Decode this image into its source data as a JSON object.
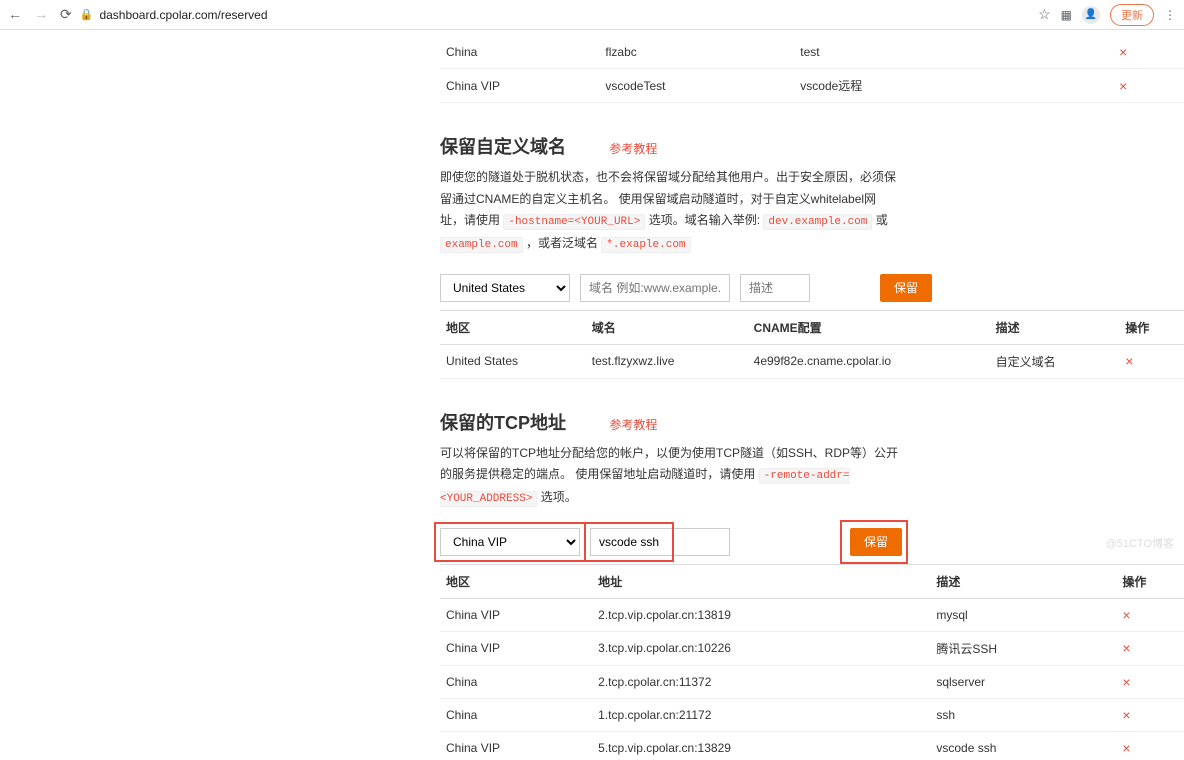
{
  "browser": {
    "url": "dashboard.cpolar.com/reserved",
    "update": "更新",
    "menu": "⋮"
  },
  "top_rows": [
    {
      "region": "China",
      "name": "flzabc",
      "desc": "test"
    },
    {
      "region": "China VIP",
      "name": "vscodeTest",
      "desc": "vscode远程"
    }
  ],
  "custom_domain": {
    "title": "保留自定义域名",
    "ref": "参考教程",
    "desc_parts": {
      "p1": "即使您的隧道处于脱机状态，也不会将保留域分配给其他用户。出于安全原因，必须保留通过CNAME的自定义主机名。 使用保留域启动隧道时，对于自定义whitelabel网址，请使用 ",
      "code1": "-hostname=<YOUR_URL>",
      "p2": " 选项。域名输入举例: ",
      "code2": "dev.example.com",
      "p3": " 或 ",
      "code3": "example.com",
      "p4": " ，或者泛域名 ",
      "code4": "*.exaple.com"
    },
    "form": {
      "region": "United States",
      "domain_ph": "域名 例如:www.example.com",
      "desc_ph": "描述",
      "btn": "保留"
    },
    "headers": {
      "region": "地区",
      "domain": "域名",
      "cname": "CNAME配置",
      "desc": "描述",
      "op": "操作"
    },
    "rows": [
      {
        "region": "United States",
        "domain": "test.flzyxwz.live",
        "cname": "4e99f82e.cname.cpolar.io",
        "desc": "自定义域名"
      }
    ]
  },
  "tcp": {
    "title": "保留的TCP地址",
    "ref": "参考教程",
    "desc_parts": {
      "p1": "可以将保留的TCP地址分配给您的帐户，以便为使用TCP隧道（如SSH、RDP等）公开的服务提供稳定的端点。 使用保留地址启动隧道时，请使用 ",
      "code1": "-remote-addr=<YOUR_ADDRESS>",
      "p2": " 选项。"
    },
    "form": {
      "region": "China VIP",
      "desc_val": "vscode ssh",
      "btn": "保留"
    },
    "headers": {
      "region": "地区",
      "addr": "地址",
      "desc": "描述",
      "op": "操作"
    },
    "rows": [
      {
        "region": "China VIP",
        "addr": "2.tcp.vip.cpolar.cn:13819",
        "desc": "mysql"
      },
      {
        "region": "China VIP",
        "addr": "3.tcp.vip.cpolar.cn:10226",
        "desc": "腾讯云SSH"
      },
      {
        "region": "China",
        "addr": "2.tcp.cpolar.cn:11372",
        "desc": "sqlserver"
      },
      {
        "region": "China",
        "addr": "1.tcp.cpolar.cn:21172",
        "desc": "ssh"
      },
      {
        "region": "China VIP",
        "addr": "5.tcp.vip.cpolar.cn:13829",
        "desc": "vscode ssh"
      }
    ]
  },
  "del_glyph": "×",
  "watermark": "@51CTO博客"
}
